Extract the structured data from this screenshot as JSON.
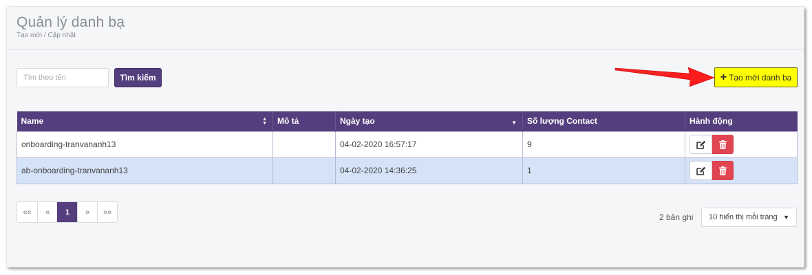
{
  "header": {
    "title": "Quản lý danh bạ",
    "breadcrumb": "Tạo mới / Cập nhật"
  },
  "search": {
    "placeholder": "Tìm theo tên",
    "value": "",
    "button_label": "Tìm kiếm"
  },
  "create_button": {
    "icon": "plus-icon",
    "label": "Tạo mới danh bạ"
  },
  "table": {
    "columns": [
      "Name",
      "Mô tả",
      "Ngày tạo",
      "Số lượng Contact",
      "Hành động"
    ],
    "rows": [
      {
        "name": "onboarding-tranvananh13",
        "description": "",
        "created": "04-02-2020 16:57:17",
        "contacts": "9"
      },
      {
        "name": "ab-onboarding-tranvananh13",
        "description": "",
        "created": "04-02-2020 14:36:25",
        "contacts": "1"
      }
    ]
  },
  "pagination": {
    "first": "««",
    "prev": "«",
    "current": "1",
    "next": "»",
    "last": "»»"
  },
  "footer": {
    "record_count": "2 bản ghi",
    "per_page": "10 hiển thị mỗi trang"
  },
  "colors": {
    "brand": "#553e7d",
    "highlight": "#ffff00",
    "danger": "#e04551",
    "row_selected": "#d4e3f7",
    "annotation_arrow": "#ee1111"
  }
}
